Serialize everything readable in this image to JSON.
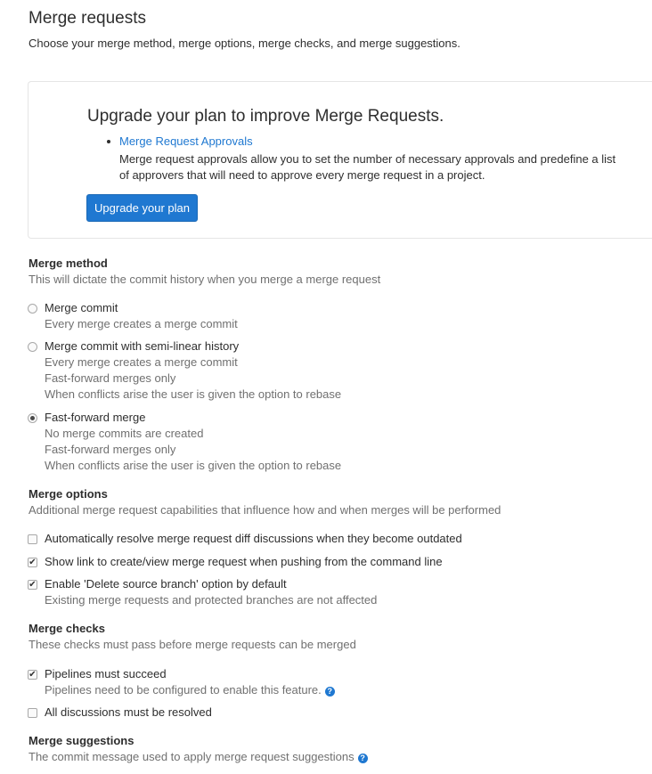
{
  "header": {
    "title": "Merge requests",
    "description": "Choose your merge method, merge options, merge checks, and merge suggestions."
  },
  "upgrade": {
    "title": "Upgrade your plan to improve Merge Requests.",
    "link_label": "Merge Request Approvals",
    "text": "Merge request approvals allow you to set the number of necessary approvals and predefine a list of approvers that will need to approve every merge request in a project.",
    "button_label": "Upgrade your plan"
  },
  "merge_method": {
    "title": "Merge method",
    "description": "This will dictate the commit history when you merge a merge request",
    "options": [
      {
        "label": "Merge commit",
        "details": [
          "Every merge creates a merge commit"
        ],
        "checked": false
      },
      {
        "label": "Merge commit with semi-linear history",
        "details": [
          "Every merge creates a merge commit",
          "Fast-forward merges only",
          "When conflicts arise the user is given the option to rebase"
        ],
        "checked": false
      },
      {
        "label": "Fast-forward merge",
        "details": [
          "No merge commits are created",
          "Fast-forward merges only",
          "When conflicts arise the user is given the option to rebase"
        ],
        "checked": true
      }
    ]
  },
  "merge_options": {
    "title": "Merge options",
    "description": "Additional merge request capabilities that influence how and when merges will be performed",
    "options": [
      {
        "label": "Automatically resolve merge request diff discussions when they become outdated",
        "checked": false
      },
      {
        "label": "Show link to create/view merge request when pushing from the command line",
        "checked": true
      },
      {
        "label": "Enable 'Delete source branch' option by default",
        "detail": "Existing merge requests and protected branches are not affected",
        "checked": true
      }
    ]
  },
  "merge_checks": {
    "title": "Merge checks",
    "description": "These checks must pass before merge requests can be merged",
    "options": [
      {
        "label": "Pipelines must succeed",
        "detail": "Pipelines need to be configured to enable this feature.",
        "checked": true
      },
      {
        "label": "All discussions must be resolved",
        "checked": false
      }
    ]
  },
  "merge_suggestions": {
    "title": "Merge suggestions",
    "description": "The commit message used to apply merge request suggestions"
  },
  "icons": {
    "check": "✔",
    "help": "?"
  }
}
